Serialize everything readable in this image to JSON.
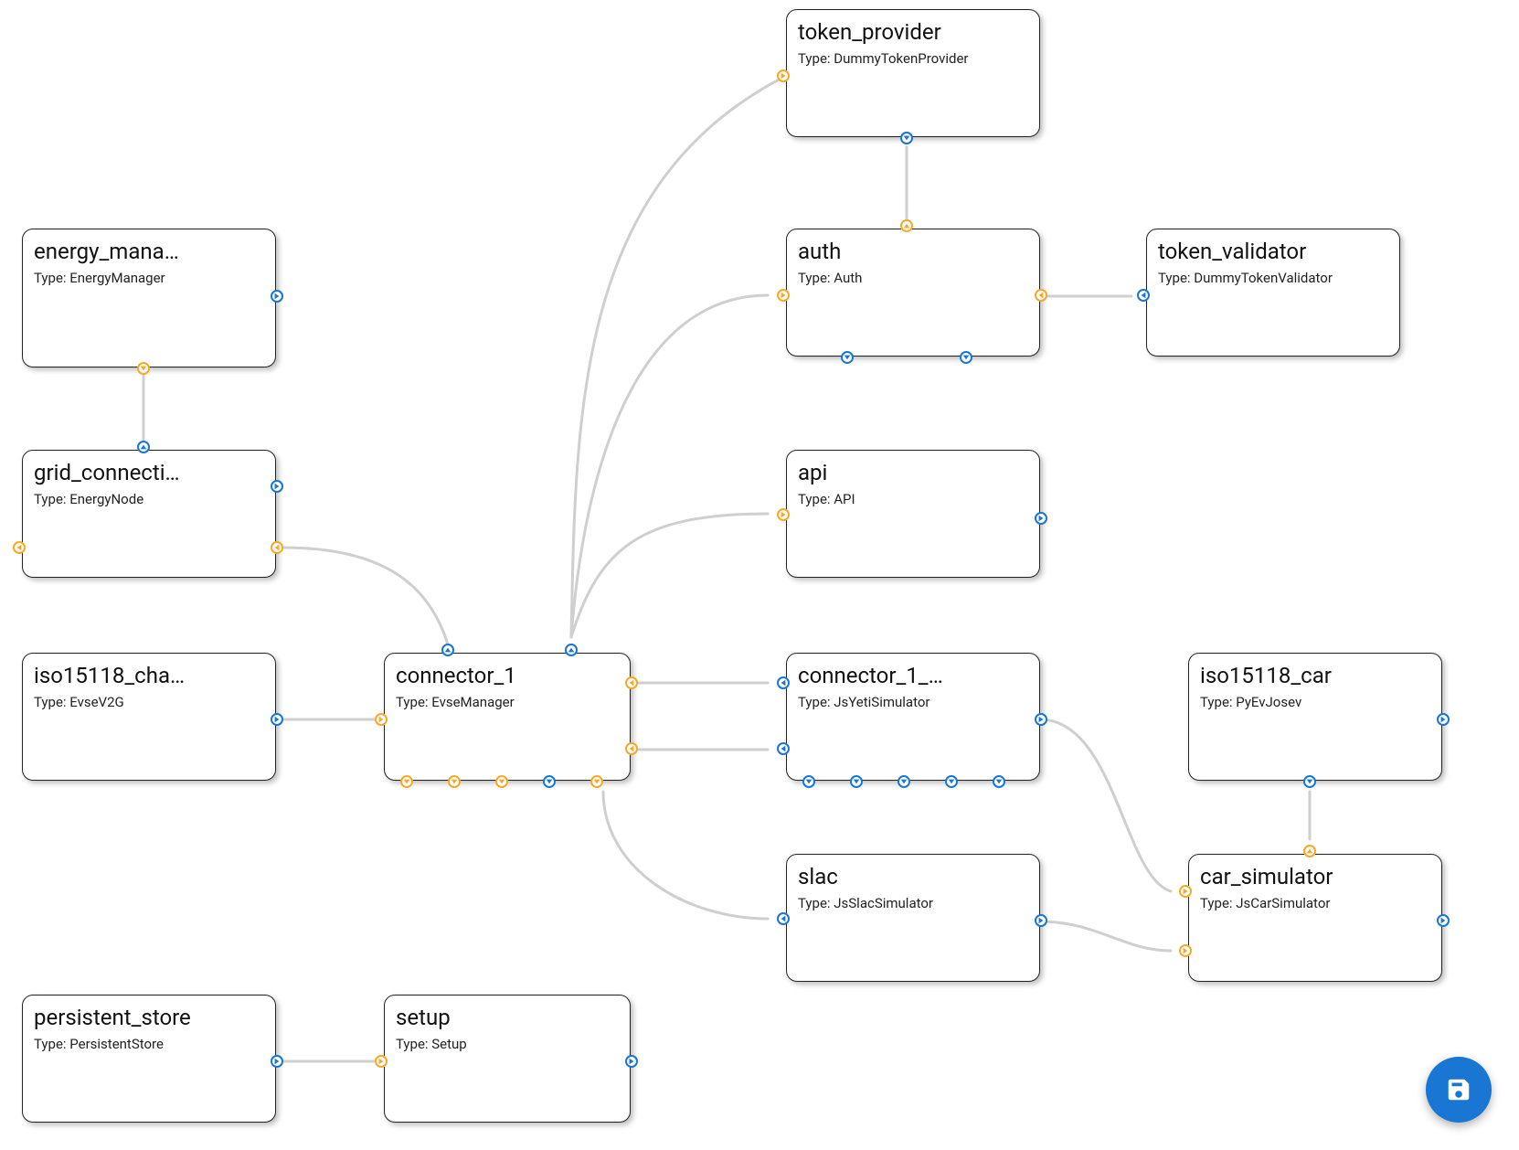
{
  "nodes": {
    "energy_manager": {
      "title": "energy_mana…",
      "type": "Type: EnergyManager"
    },
    "grid_connection": {
      "title": "grid_connecti…",
      "type": "Type: EnergyNode"
    },
    "iso15118_charger": {
      "title": "iso15118_cha…",
      "type": "Type: EvseV2G"
    },
    "persistent_store": {
      "title": "persistent_store",
      "type": "Type: PersistentStore"
    },
    "connector_1": {
      "title": "connector_1",
      "type": "Type: EvseManager"
    },
    "setup": {
      "title": "setup",
      "type": "Type: Setup"
    },
    "token_provider": {
      "title": "token_provider",
      "type": "Type: DummyTokenProvider"
    },
    "auth": {
      "title": "auth",
      "type": "Type: Auth"
    },
    "api": {
      "title": "api",
      "type": "Type: API"
    },
    "connector_1_sim": {
      "title": "connector_1_…",
      "type": "Type: JsYetiSimulator"
    },
    "slac": {
      "title": "slac",
      "type": "Type: JsSlacSimulator"
    },
    "token_validator": {
      "title": "token_validator",
      "type": "Type: DummyTokenValidator"
    },
    "iso15118_car": {
      "title": "iso15118_car",
      "type": "Type: PyEvJosev"
    },
    "car_simulator": {
      "title": "car_simulator",
      "type": "Type: JsCarSimulator"
    }
  },
  "fab": {
    "label": "Save"
  },
  "colors": {
    "blue": "#1976d2",
    "yellow": "#f9a825",
    "edge": "#cfcfcf"
  }
}
